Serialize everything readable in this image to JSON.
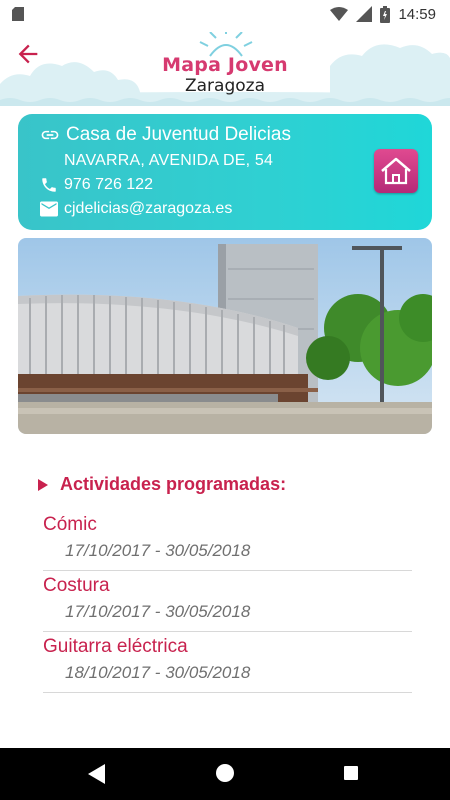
{
  "status_bar": {
    "time": "14:59"
  },
  "header": {
    "logo_title": "Mapa Joven",
    "logo_subtitle": "Zaragoza"
  },
  "center": {
    "name": "Casa de Juventud Delicias",
    "address": "NAVARRA, AVENIDA DE, 54",
    "phone": "976 726 122",
    "email": "cjdelicias@zaragoza.es"
  },
  "activities": {
    "title": "Actividades programadas:",
    "items": [
      {
        "name": "Cómic",
        "dates": "17/10/2017 - 30/05/2018"
      },
      {
        "name": "Costura",
        "dates": "17/10/2017 - 30/05/2018"
      },
      {
        "name": "Guitarra eléctrica",
        "dates": "18/10/2017 - 30/05/2018"
      }
    ]
  },
  "colors": {
    "accent": "#c8224e",
    "logo_pink": "#d63a70",
    "card_teal": "#2fd0d2",
    "house_button": "#c2327e"
  },
  "icons": {
    "back": "arrow-left-icon",
    "link": "link-icon",
    "phone": "phone-icon",
    "mail": "mail-icon",
    "house": "house-icon"
  }
}
